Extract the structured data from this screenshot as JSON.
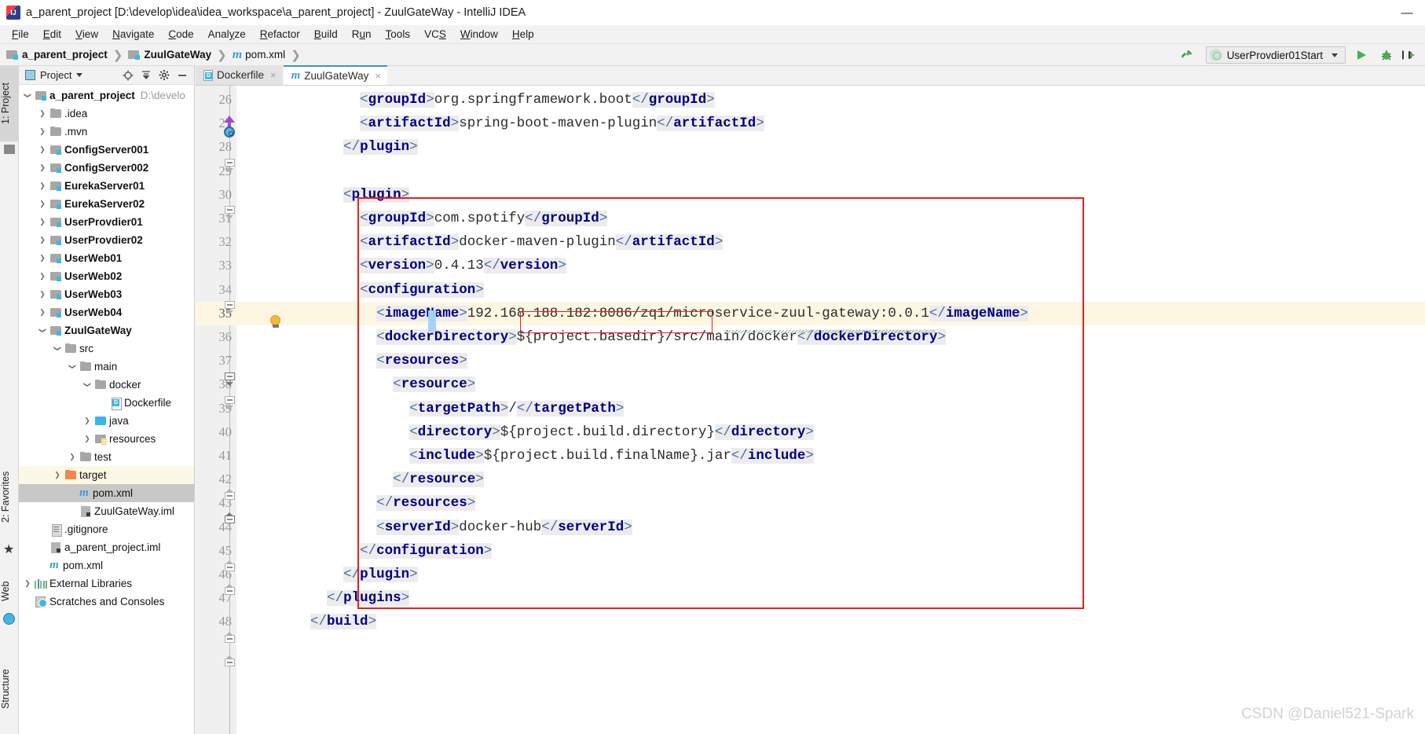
{
  "window": {
    "title": "a_parent_project [D:\\develop\\idea\\idea_workspace\\a_parent_project] - ZuulGateWay - IntelliJ IDEA",
    "minimize_label": "—"
  },
  "menubar": {
    "items": [
      {
        "label": "File",
        "mnemonic": "F"
      },
      {
        "label": "Edit",
        "mnemonic": "E"
      },
      {
        "label": "View",
        "mnemonic": "V"
      },
      {
        "label": "Navigate",
        "mnemonic": "N"
      },
      {
        "label": "Code",
        "mnemonic": "C"
      },
      {
        "label": "Analyze",
        "mnemonic": "y"
      },
      {
        "label": "Refactor",
        "mnemonic": "R"
      },
      {
        "label": "Build",
        "mnemonic": "B"
      },
      {
        "label": "Run",
        "mnemonic": "u"
      },
      {
        "label": "Tools",
        "mnemonic": "T"
      },
      {
        "label": "VCS",
        "mnemonic": "S"
      },
      {
        "label": "Window",
        "mnemonic": "W"
      },
      {
        "label": "Help",
        "mnemonic": "H"
      }
    ]
  },
  "breadcrumb": {
    "items": [
      {
        "label": "a_parent_project",
        "icon": "module-folder-icon",
        "bold": true
      },
      {
        "label": "ZuulGateWay",
        "icon": "module-folder-icon",
        "bold": true
      },
      {
        "label": "pom.xml",
        "icon": "maven-icon",
        "bold": false
      }
    ],
    "separator": "❯"
  },
  "toolbar_right": {
    "hammer_icon": "build-hammer-icon",
    "run_config": "UserProvdier01Start",
    "run_button": "run-icon",
    "debug_button": "debug-icon",
    "coverage_button": "run-with-coverage-icon"
  },
  "left_tool_strip": {
    "tabs": [
      {
        "label": "1: Project",
        "selected": true
      },
      {
        "label": "2: Favorites",
        "selected": false
      },
      {
        "label": "Web",
        "selected": false
      },
      {
        "label": "Structure",
        "selected": false
      }
    ]
  },
  "project_panel": {
    "title": "Project",
    "header_icons": [
      "target-scroll-from-source-icon",
      "collapse-all-icon",
      "settings-gear-icon",
      "hide-panel-icon"
    ],
    "tree": [
      {
        "depth": 0,
        "twist": "down",
        "icon": "module-icon",
        "label": "a_parent_project",
        "bold": true,
        "suffix": "D:\\develo"
      },
      {
        "depth": 1,
        "twist": "right",
        "icon": "folder-icon",
        "label": ".idea",
        "bold": false
      },
      {
        "depth": 1,
        "twist": "right",
        "icon": "folder-icon",
        "label": ".mvn",
        "bold": false
      },
      {
        "depth": 1,
        "twist": "right",
        "icon": "module-icon",
        "label": "ConfigServer001",
        "bold": true
      },
      {
        "depth": 1,
        "twist": "right",
        "icon": "module-icon",
        "label": "ConfigServer002",
        "bold": true
      },
      {
        "depth": 1,
        "twist": "right",
        "icon": "module-icon",
        "label": "EurekaServer01",
        "bold": true
      },
      {
        "depth": 1,
        "twist": "right",
        "icon": "module-icon",
        "label": "EurekaServer02",
        "bold": true
      },
      {
        "depth": 1,
        "twist": "right",
        "icon": "module-icon",
        "label": "UserProvdier01",
        "bold": true
      },
      {
        "depth": 1,
        "twist": "right",
        "icon": "module-icon",
        "label": "UserProvdier02",
        "bold": true
      },
      {
        "depth": 1,
        "twist": "right",
        "icon": "module-icon",
        "label": "UserWeb01",
        "bold": true
      },
      {
        "depth": 1,
        "twist": "right",
        "icon": "module-icon",
        "label": "UserWeb02",
        "bold": true
      },
      {
        "depth": 1,
        "twist": "right",
        "icon": "module-icon",
        "label": "UserWeb03",
        "bold": true
      },
      {
        "depth": 1,
        "twist": "right",
        "icon": "module-icon",
        "label": "UserWeb04",
        "bold": true
      },
      {
        "depth": 1,
        "twist": "down",
        "icon": "module-icon",
        "label": "ZuulGateWay",
        "bold": true
      },
      {
        "depth": 2,
        "twist": "down",
        "icon": "folder-icon",
        "label": "src",
        "bold": false
      },
      {
        "depth": 3,
        "twist": "down",
        "icon": "folder-icon",
        "label": "main",
        "bold": false
      },
      {
        "depth": 4,
        "twist": "down",
        "icon": "folder-icon",
        "label": "docker",
        "bold": false
      },
      {
        "depth": 5,
        "twist": "none",
        "icon": "dockerfile-icon",
        "label": "Dockerfile",
        "bold": false
      },
      {
        "depth": 4,
        "twist": "right",
        "icon": "sources-root-icon",
        "label": "java",
        "bold": false
      },
      {
        "depth": 4,
        "twist": "right",
        "icon": "resources-root-icon",
        "label": "resources",
        "bold": false
      },
      {
        "depth": 3,
        "twist": "right",
        "icon": "folder-icon",
        "label": "test",
        "bold": false
      },
      {
        "depth": 2,
        "twist": "right",
        "icon": "target-folder-icon",
        "label": "target",
        "bold": false,
        "row_highlight": "yellow"
      },
      {
        "depth": 3,
        "twist": "none",
        "icon": "maven-icon",
        "label": "pom.xml",
        "bold": false,
        "row_highlight": "grey"
      },
      {
        "depth": 3,
        "twist": "none",
        "icon": "iml-icon",
        "label": "ZuulGateWay.iml",
        "bold": false
      },
      {
        "depth": 1,
        "twist": "none",
        "icon": "text-file-icon",
        "label": ".gitignore",
        "bold": false
      },
      {
        "depth": 1,
        "twist": "none",
        "icon": "iml-icon",
        "label": "a_parent_project.iml",
        "bold": false
      },
      {
        "depth": 1,
        "twist": "none",
        "icon": "maven-icon",
        "label": "pom.xml",
        "bold": false
      },
      {
        "depth": 0,
        "twist": "right",
        "icon": "libraries-icon",
        "label": "External Libraries",
        "bold": false
      },
      {
        "depth": 0,
        "twist": "none",
        "icon": "scratches-icon",
        "label": "Scratches and Consoles",
        "bold": false
      }
    ]
  },
  "editor": {
    "tabs": [
      {
        "label": "Dockerfile",
        "icon": "dockerfile-icon",
        "active": false,
        "close": "×"
      },
      {
        "label": "ZuulGateWay",
        "icon": "maven-icon",
        "active": true,
        "close": "×"
      }
    ],
    "current_line": 35,
    "line_numbers": [
      26,
      27,
      28,
      29,
      30,
      31,
      32,
      33,
      34,
      35,
      36,
      37,
      38,
      39,
      40,
      41,
      42,
      43,
      44,
      45,
      46,
      47,
      48
    ],
    "code_lines": [
      {
        "num": 26,
        "indent": 8,
        "segments": [
          {
            "t": "<",
            "c": "brk"
          },
          {
            "t": "groupId",
            "c": "tagc"
          },
          {
            "t": ">",
            "c": "brk"
          },
          {
            "t": "org.springframework.boot",
            "c": "txt"
          },
          {
            "t": "</",
            "c": "brk"
          },
          {
            "t": "groupId",
            "c": "tagc"
          },
          {
            "t": ">",
            "c": "brk"
          }
        ]
      },
      {
        "num": 27,
        "indent": 8,
        "segments": [
          {
            "t": "<",
            "c": "brk"
          },
          {
            "t": "artifactId",
            "c": "tagc"
          },
          {
            "t": ">",
            "c": "brk"
          },
          {
            "t": "spring-boot-maven-plugin",
            "c": "txt"
          },
          {
            "t": "</",
            "c": "brk"
          },
          {
            "t": "artifactId",
            "c": "tagc"
          },
          {
            "t": ">",
            "c": "brk"
          }
        ]
      },
      {
        "num": 28,
        "indent": 6,
        "segments": [
          {
            "t": "</",
            "c": "brk"
          },
          {
            "t": "plugin",
            "c": "tagc"
          },
          {
            "t": ">",
            "c": "brk"
          }
        ]
      },
      {
        "num": 29,
        "indent": 0,
        "segments": []
      },
      {
        "num": 30,
        "indent": 6,
        "segments": [
          {
            "t": "<",
            "c": "brk"
          },
          {
            "t": "plugin",
            "c": "tagc"
          },
          {
            "t": ">",
            "c": "brk"
          }
        ]
      },
      {
        "num": 31,
        "indent": 8,
        "segments": [
          {
            "t": "<",
            "c": "brk"
          },
          {
            "t": "groupId",
            "c": "tagc"
          },
          {
            "t": ">",
            "c": "brk"
          },
          {
            "t": "com.spotify",
            "c": "txt"
          },
          {
            "t": "</",
            "c": "brk"
          },
          {
            "t": "groupId",
            "c": "tagc"
          },
          {
            "t": ">",
            "c": "brk"
          }
        ]
      },
      {
        "num": 32,
        "indent": 8,
        "segments": [
          {
            "t": "<",
            "c": "brk"
          },
          {
            "t": "artifactId",
            "c": "tagc"
          },
          {
            "t": ">",
            "c": "brk"
          },
          {
            "t": "docker-maven-plugin",
            "c": "txt"
          },
          {
            "t": "</",
            "c": "brk"
          },
          {
            "t": "artifactId",
            "c": "tagc"
          },
          {
            "t": ">",
            "c": "brk"
          }
        ]
      },
      {
        "num": 33,
        "indent": 8,
        "segments": [
          {
            "t": "<",
            "c": "brk"
          },
          {
            "t": "version",
            "c": "tagc"
          },
          {
            "t": ">",
            "c": "brk"
          },
          {
            "t": "0.4.13",
            "c": "txt"
          },
          {
            "t": "</",
            "c": "brk"
          },
          {
            "t": "version",
            "c": "tagc"
          },
          {
            "t": ">",
            "c": "brk"
          }
        ]
      },
      {
        "num": 34,
        "indent": 8,
        "segments": [
          {
            "t": "<",
            "c": "brk"
          },
          {
            "t": "configuration",
            "c": "tagc"
          },
          {
            "t": ">",
            "c": "brk"
          }
        ]
      },
      {
        "num": 35,
        "indent": 10,
        "segments": [
          {
            "t": "<",
            "c": "brk"
          },
          {
            "t": "imageName",
            "c": "tagc"
          },
          {
            "t": ">",
            "c": "brk"
          },
          {
            "t": "192.168.188.182:8086/zq1/microservice-zuul-gateway:0.0.1",
            "c": "txt"
          },
          {
            "t": "</",
            "c": "brk"
          },
          {
            "t": "imageName",
            "c": "tagc"
          },
          {
            "t": ">",
            "c": "brk"
          }
        ]
      },
      {
        "num": 36,
        "indent": 10,
        "segments": [
          {
            "t": "<",
            "c": "brk"
          },
          {
            "t": "dockerDirectory",
            "c": "tagc"
          },
          {
            "t": ">",
            "c": "brk"
          },
          {
            "t": "${project.basedir}/src/main/docker",
            "c": "txt"
          },
          {
            "t": "</",
            "c": "brk"
          },
          {
            "t": "dockerDirectory",
            "c": "tagc"
          },
          {
            "t": ">",
            "c": "brk"
          }
        ]
      },
      {
        "num": 37,
        "indent": 10,
        "segments": [
          {
            "t": "<",
            "c": "brk"
          },
          {
            "t": "resources",
            "c": "tagc"
          },
          {
            "t": ">",
            "c": "brk"
          }
        ]
      },
      {
        "num": 38,
        "indent": 12,
        "segments": [
          {
            "t": "<",
            "c": "brk"
          },
          {
            "t": "resource",
            "c": "tagc"
          },
          {
            "t": ">",
            "c": "brk"
          }
        ]
      },
      {
        "num": 39,
        "indent": 14,
        "segments": [
          {
            "t": "<",
            "c": "brk"
          },
          {
            "t": "targetPath",
            "c": "tagc"
          },
          {
            "t": ">",
            "c": "brk"
          },
          {
            "t": "/",
            "c": "txt"
          },
          {
            "t": "</",
            "c": "brk"
          },
          {
            "t": "targetPath",
            "c": "tagc"
          },
          {
            "t": ">",
            "c": "brk"
          }
        ]
      },
      {
        "num": 40,
        "indent": 14,
        "segments": [
          {
            "t": "<",
            "c": "brk"
          },
          {
            "t": "directory",
            "c": "tagc"
          },
          {
            "t": ">",
            "c": "brk"
          },
          {
            "t": "${project.build.directory}",
            "c": "txt"
          },
          {
            "t": "</",
            "c": "brk"
          },
          {
            "t": "directory",
            "c": "tagc"
          },
          {
            "t": ">",
            "c": "brk"
          }
        ]
      },
      {
        "num": 41,
        "indent": 14,
        "segments": [
          {
            "t": "<",
            "c": "brk"
          },
          {
            "t": "include",
            "c": "tagc"
          },
          {
            "t": ">",
            "c": "brk"
          },
          {
            "t": "${project.build.finalName}.jar",
            "c": "txt"
          },
          {
            "t": "</",
            "c": "brk"
          },
          {
            "t": "include",
            "c": "tagc"
          },
          {
            "t": ">",
            "c": "brk"
          }
        ]
      },
      {
        "num": 42,
        "indent": 12,
        "segments": [
          {
            "t": "</",
            "c": "brk"
          },
          {
            "t": "resource",
            "c": "tagc"
          },
          {
            "t": ">",
            "c": "brk"
          }
        ]
      },
      {
        "num": 43,
        "indent": 10,
        "segments": [
          {
            "t": "</",
            "c": "brk"
          },
          {
            "t": "resources",
            "c": "tagc"
          },
          {
            "t": ">",
            "c": "brk"
          }
        ]
      },
      {
        "num": 44,
        "indent": 10,
        "segments": [
          {
            "t": "<",
            "c": "brk"
          },
          {
            "t": "serverId",
            "c": "tagc"
          },
          {
            "t": ">",
            "c": "brk"
          },
          {
            "t": "docker-hub",
            "c": "txt"
          },
          {
            "t": "</",
            "c": "brk"
          },
          {
            "t": "serverId",
            "c": "tagc"
          },
          {
            "t": ">",
            "c": "brk"
          }
        ]
      },
      {
        "num": 45,
        "indent": 8,
        "segments": [
          {
            "t": "</",
            "c": "brk"
          },
          {
            "t": "configuration",
            "c": "tagc"
          },
          {
            "t": ">",
            "c": "brk"
          }
        ]
      },
      {
        "num": 46,
        "indent": 6,
        "segments": [
          {
            "t": "</",
            "c": "brk"
          },
          {
            "t": "plugin",
            "c": "tagc"
          },
          {
            "t": ">",
            "c": "brk"
          }
        ]
      },
      {
        "num": 47,
        "indent": 4,
        "segments": [
          {
            "t": "</",
            "c": "brk"
          },
          {
            "t": "plugins",
            "c": "tagc"
          },
          {
            "t": ">",
            "c": "brk"
          }
        ]
      },
      {
        "num": 48,
        "indent": 2,
        "segments": [
          {
            "t": "</",
            "c": "brk"
          },
          {
            "t": "build",
            "c": "tagc"
          },
          {
            "t": ">",
            "c": "brk"
          }
        ]
      }
    ],
    "annotations": {
      "outer_box_label": "docker-maven-plugin-block",
      "inner_box_label": "registry-host-highlight",
      "inner_box_text": "192.168.188.182:8086/zq1",
      "intention_bulb": "intention-bulb-icon",
      "run_marker": "run-gutter-marker"
    }
  },
  "watermark": "CSDN @Daniel521-Spark",
  "colors": {
    "accent_blue": "#3c93d4",
    "annotation_red": "#e52020",
    "tag_navy": "#000080",
    "current_line": "#fdf7e2",
    "selected_row": "#c8c8c8"
  }
}
